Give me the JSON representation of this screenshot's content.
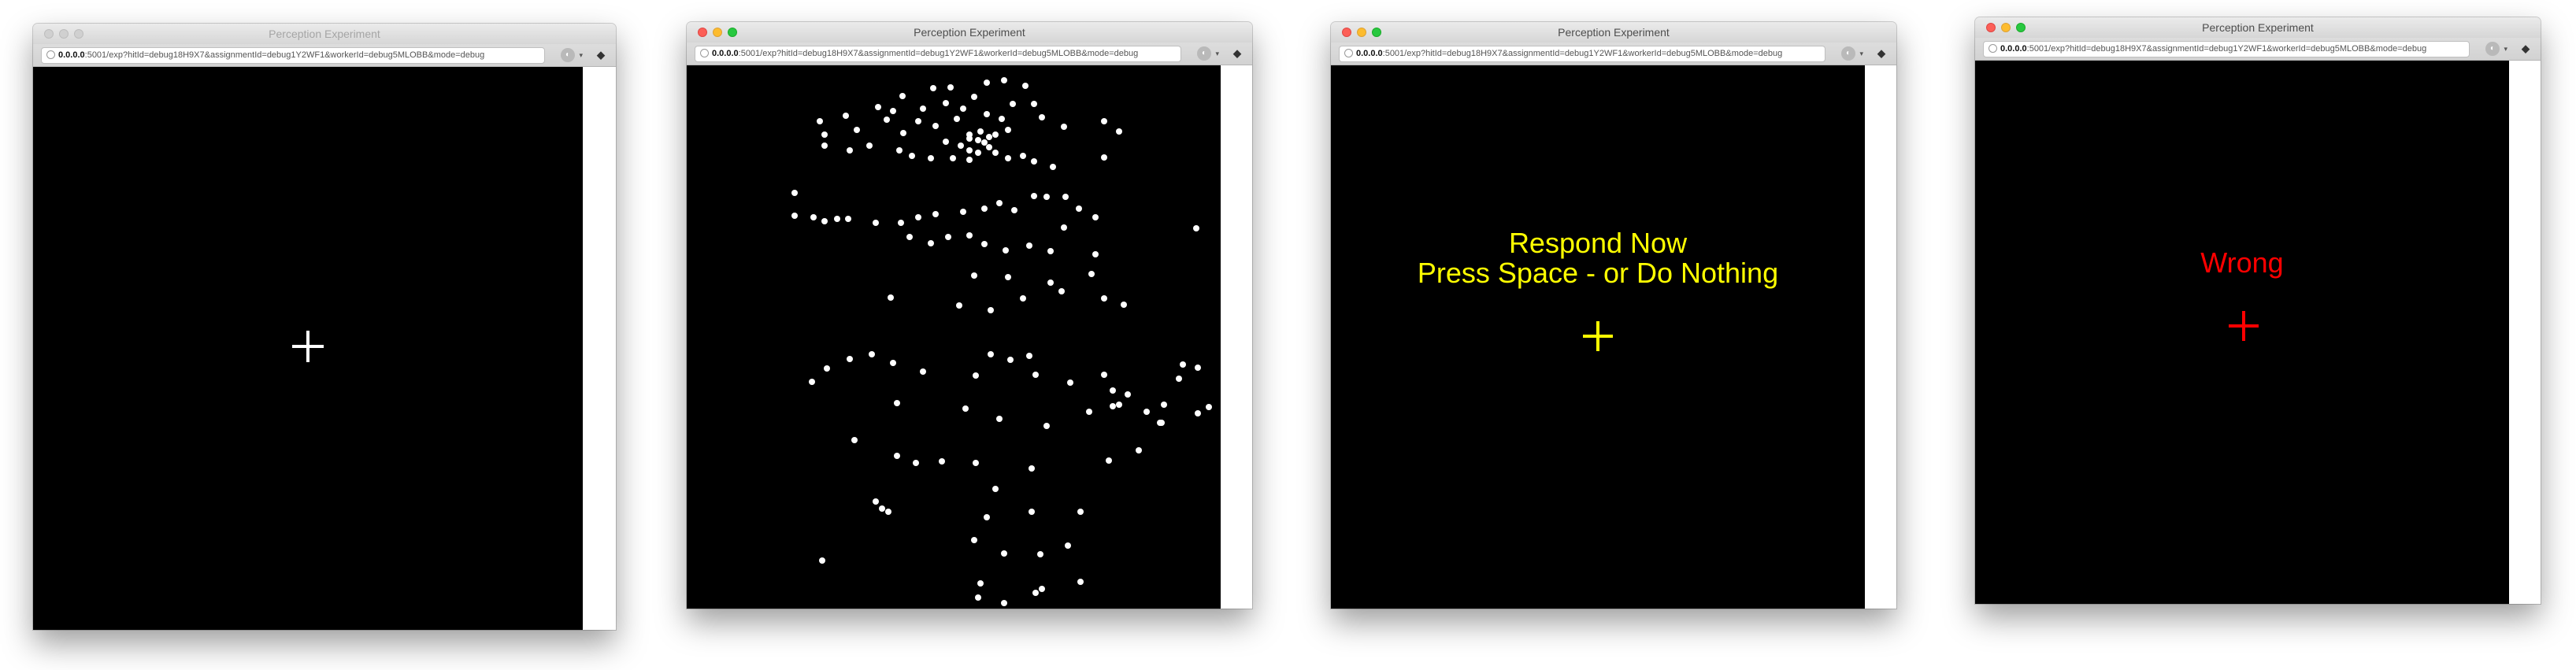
{
  "browser": {
    "title": "Perception Experiment",
    "url_host": "0.0.0.0",
    "url_path_1": ":5001/exp?hitId=debug18H9X7&assignmentId=debug1Y2WF1&workerId=debug5MLOBB&mode=debug",
    "url_path_2": ":5001/exp?hitId=debug18H9X7&assignmentId=debug1Y2WF1&workerId=debug5MLOBB&mode=debug"
  },
  "screens": [
    {
      "id": "fixation",
      "cross_color": "#ffffff"
    },
    {
      "id": "dots",
      "dot_color": "#ffffff"
    },
    {
      "id": "respond",
      "line1": "Respond Now",
      "line2": "Press Space - or Do Nothing",
      "color": "#ffff00"
    },
    {
      "id": "feedback",
      "text": "Wrong",
      "color": "#ff0000"
    }
  ],
  "colors": {
    "stage": "#000000",
    "chrome": "#ececec"
  }
}
